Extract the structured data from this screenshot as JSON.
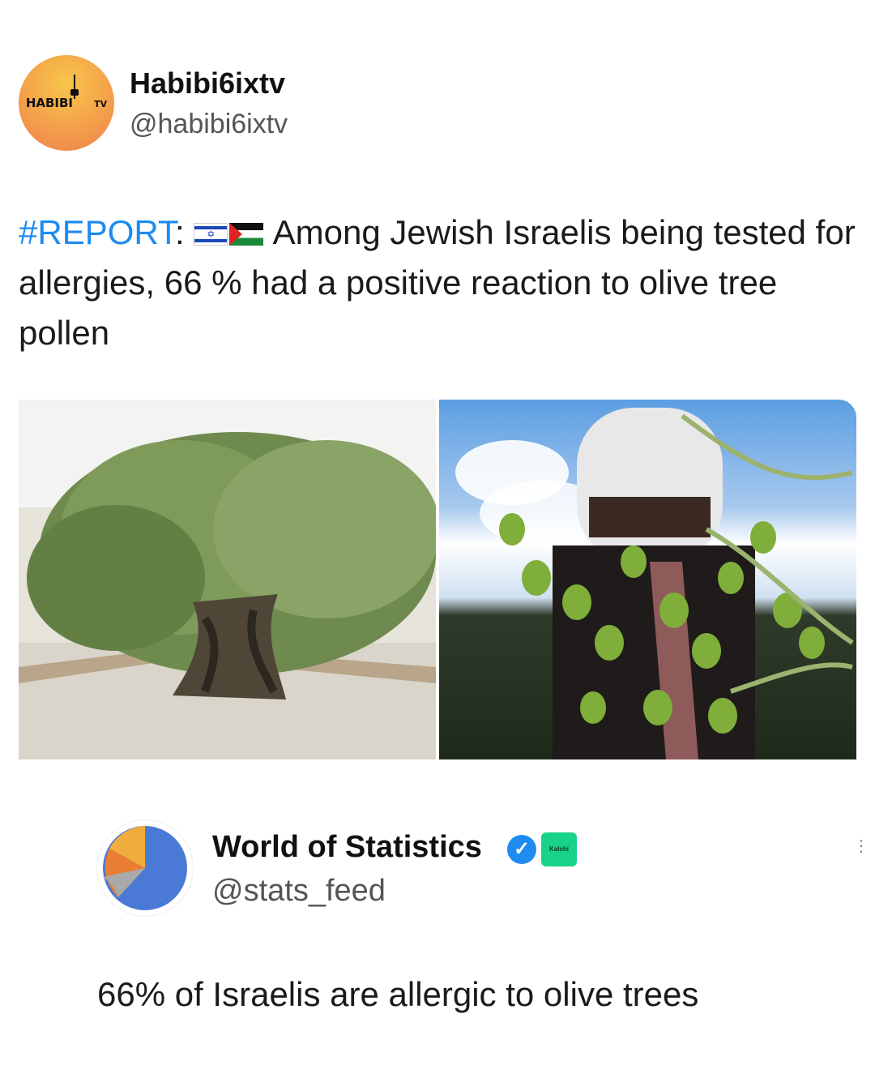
{
  "post": {
    "author_name": "Habibi6ixtv",
    "author_handle": "@habibi6ixtv",
    "avatar_text_left": "HABIBI",
    "avatar_text_right": "TV",
    "hashtag": "#REPORT",
    "text_after_flags": "Among Jewish Israelis being tested for allergies, 66 % had a positive reaction to olive tree pollen",
    "flags": [
      "israel-flag",
      "palestine-flag"
    ],
    "images": [
      "olive-tree-photo",
      "olive-harvest-photo"
    ]
  },
  "quoted": {
    "author_name": "World of Statistics",
    "author_handle": "@stats_feed",
    "verified": true,
    "badge": "Kalshi",
    "text": "66% of Israelis are allergic to olive trees"
  },
  "colors": {
    "hashtag": "#1d8bf0",
    "verified": "#1d8bf0",
    "kalshi": "#19d28a"
  }
}
